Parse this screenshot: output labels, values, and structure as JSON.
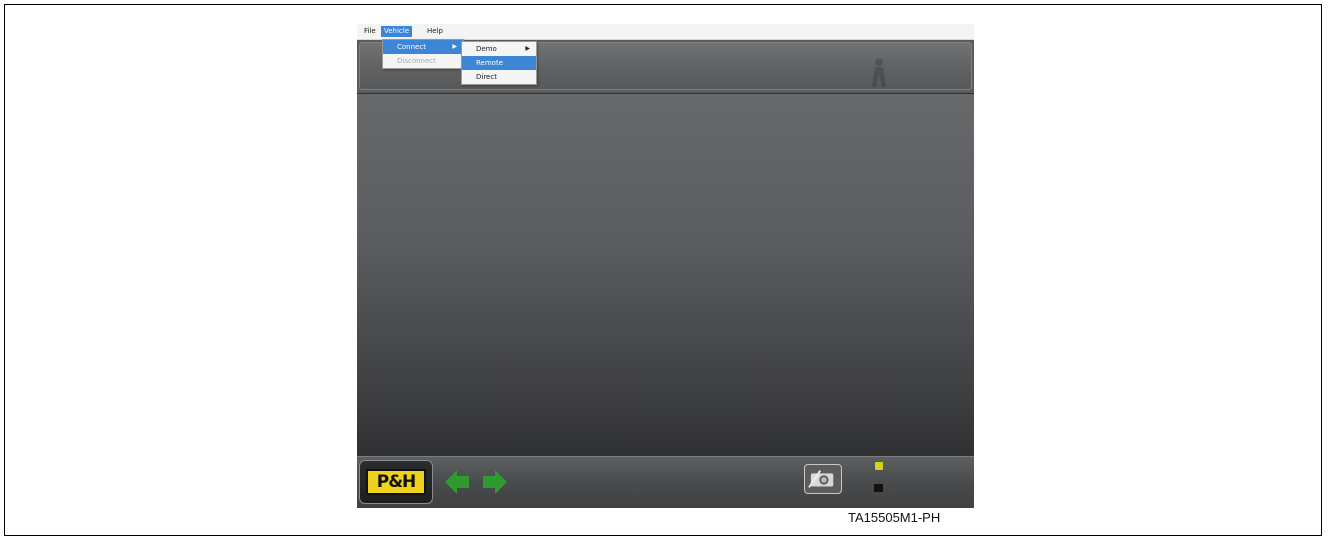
{
  "menubar": {
    "items": [
      {
        "label": "File"
      },
      {
        "label": "Vehicle"
      },
      {
        "label": "Help"
      }
    ]
  },
  "vehicle_menu": {
    "items": [
      {
        "label": "Connect",
        "has_submenu": true,
        "highlighted": true
      },
      {
        "label": "Disconnect",
        "disabled": true
      }
    ]
  },
  "connect_submenu": {
    "items": [
      {
        "label": "Demo",
        "has_submenu": true
      },
      {
        "label": "Remote",
        "selected": true
      },
      {
        "label": "Direct"
      }
    ]
  },
  "bottombar": {
    "logo_text": "P&H",
    "back_icon": "arrow-left-icon",
    "forward_icon": "arrow-right-icon",
    "camera_icon": "camera-icon"
  },
  "colors": {
    "logo_yellow": "#f0d11b",
    "arrow_green": "#2f9a2f",
    "menu_highlight": "#3d86d6",
    "status_yellow": "#d4d21a"
  },
  "caption": "TA15505M1-PH"
}
